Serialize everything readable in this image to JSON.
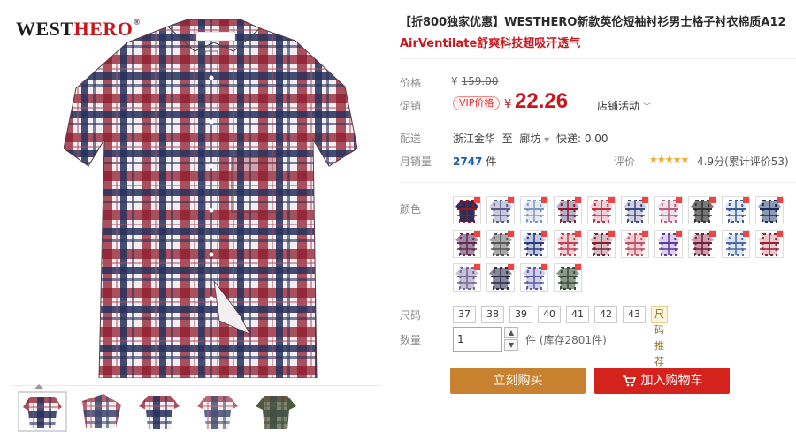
{
  "brand": {
    "logo_west": "WEST",
    "logo_hero": "HERO",
    "logo_reg": "®"
  },
  "product": {
    "title": "【折800独家优惠】WESTHERO新款英伦短袖衬衫男士格子衬衣棉质A12",
    "subtitle": "AirVentilate舒爽科技超吸汗透气"
  },
  "pricing": {
    "orig_label": "价格",
    "orig_symbol": "¥",
    "orig_price": "159.00",
    "promo_label": "促销",
    "vip_badge": "VIP价格",
    "cur_symbol": "¥",
    "cur_price": "22.26",
    "store_activity": "店铺活动"
  },
  "shipping": {
    "label": "配送",
    "from": "浙江金华",
    "to_word": "至",
    "to": "廊坊",
    "fee_label": "快递:",
    "fee": "0.00"
  },
  "sales": {
    "label": "月销量",
    "count": "2747",
    "unit": "件",
    "rating_label": "评价",
    "stars": "★★★★★",
    "rating": "4.9分(累计评价53)"
  },
  "color": {
    "label": "颜色",
    "swatch_count": 24
  },
  "size": {
    "label": "尺码",
    "options": [
      "37",
      "38",
      "39",
      "40",
      "41",
      "42",
      "43"
    ],
    "chart_link": "尺码推荐"
  },
  "quantity": {
    "label": "数量",
    "value": "1",
    "unit": "件",
    "stock": "(库存2801件)"
  },
  "actions": {
    "buy_now": "立刻购买",
    "add_cart": "加入购物车"
  },
  "colors": {
    "price_red": "#c9161d",
    "buy_btn": "#c8812f",
    "cart_btn": "#d4221c",
    "plaid_red": "#8e1b2c",
    "plaid_navy": "#27305a"
  },
  "icons": {
    "cart": "shopping-cart-icon",
    "dropdown": "chevron-down-icon",
    "qty_up": "triangle-up-icon",
    "qty_down": "triangle-down-icon"
  }
}
